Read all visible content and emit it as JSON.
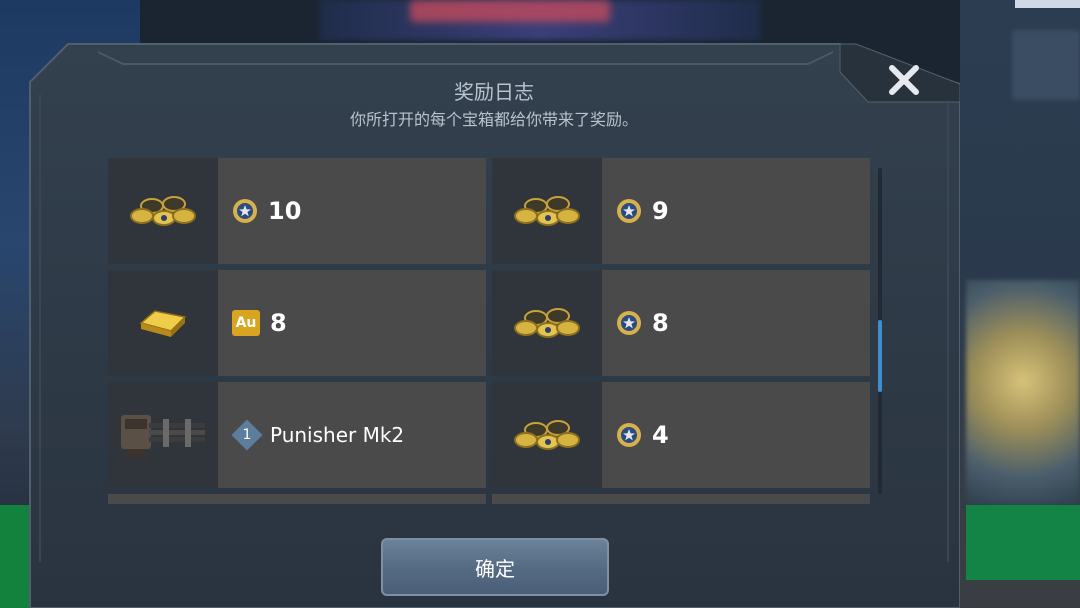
{
  "dialog": {
    "title": "奖励日志",
    "subtitle": "你所打开的每个宝箱都给你带来了奖励。",
    "close_icon": "close-icon",
    "confirm_label": "确定"
  },
  "rewards": [
    {
      "item_icon": "silver-coins-pile-icon",
      "currency_icon": "silver-coin-icon",
      "value": "10"
    },
    {
      "item_icon": "silver-coins-pile-icon",
      "currency_icon": "silver-coin-icon",
      "value": "9"
    },
    {
      "item_icon": "gold-bar-icon",
      "currency_icon": "gold-au-icon",
      "currency_text": "Au",
      "value": "8"
    },
    {
      "item_icon": "silver-coins-pile-icon",
      "currency_icon": "silver-coin-icon",
      "value": "8"
    },
    {
      "item_icon": "gatling-weapon-icon",
      "level_badge": "1",
      "value": "Punisher Mk2"
    },
    {
      "item_icon": "silver-coins-pile-icon",
      "currency_icon": "silver-coin-icon",
      "value": "4"
    }
  ],
  "colors": {
    "card_bg": "#4a4a4a",
    "thumb_bg": "#2f353b",
    "panel_bg": "#2b3440",
    "accent_blue": "#3f8fcf",
    "gold": "#e2b434"
  }
}
